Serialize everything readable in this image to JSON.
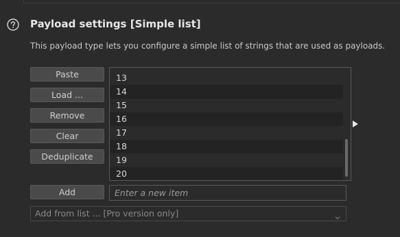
{
  "section": {
    "title": "Payload settings [Simple list]",
    "description": "This payload type lets you configure a simple list of strings that are used as payloads."
  },
  "buttons": {
    "paste": "Paste",
    "load": "Load ...",
    "remove": "Remove",
    "clear": "Clear",
    "deduplicate": "Deduplicate",
    "add": "Add"
  },
  "list": {
    "items": [
      "13",
      "14",
      "15",
      "16",
      "17",
      "18",
      "19",
      "20"
    ]
  },
  "new_item": {
    "placeholder": "Enter a new item",
    "value": ""
  },
  "add_from_list": {
    "label": "Add from list ... [Pro version only]"
  },
  "icons": {
    "help": "help-circle-icon",
    "expand": "expand-right-arrow-icon",
    "dropdown": "chevron-down-icon"
  }
}
